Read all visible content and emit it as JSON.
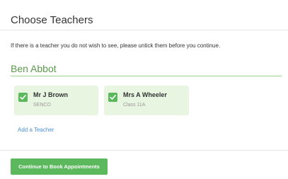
{
  "dialog": {
    "title": "Choose Teachers",
    "instructions": "If there is a teacher you do not wish to see, please untick them before you continue."
  },
  "student": {
    "name": "Ben Abbot"
  },
  "teachers": [
    {
      "name": "Mr J Brown",
      "role": "SENCO",
      "checked": true
    },
    {
      "name": "Mrs A Wheeler",
      "role": "Class 11A",
      "checked": true
    }
  ],
  "actions": {
    "add_teacher_label": "Add a Teacher",
    "continue_label": "Continue to Book Appointments"
  },
  "colors": {
    "accent_green": "#5cb85c",
    "card_background": "#e8f5e1",
    "link_blue": "#4a90d9",
    "student_name": "#5a9a4a"
  },
  "icons": {
    "checkbox": "checkmark-icon"
  }
}
